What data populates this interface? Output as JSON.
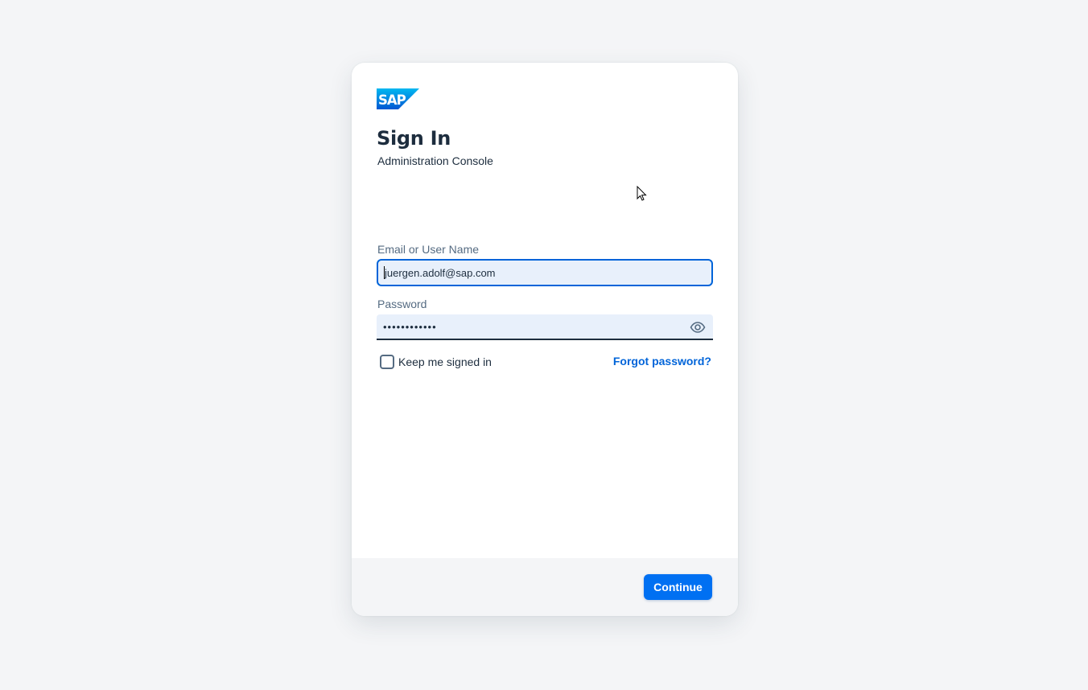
{
  "brand": {
    "logo_text": "SAP",
    "logo_icon": "sap-logo"
  },
  "colors": {
    "accent": "#0064d9",
    "button": "#0070f2",
    "input_background": "#e8f0fb",
    "page_background": "#f4f5f7",
    "text": "#1d2d3e",
    "label": "#556b82"
  },
  "header": {
    "title": "Sign In",
    "subtitle": "Administration Console"
  },
  "form": {
    "email": {
      "label": "Email or User Name",
      "value": "juergen.adolf@sap.com"
    },
    "password": {
      "label": "Password",
      "masked_value": "••••••••••••",
      "reveal_icon": "eye-icon"
    },
    "keep_signed_in": {
      "label": "Keep me signed in",
      "checked": false
    },
    "forgot_password": "Forgot password?"
  },
  "footer": {
    "continue_label": "Continue"
  }
}
